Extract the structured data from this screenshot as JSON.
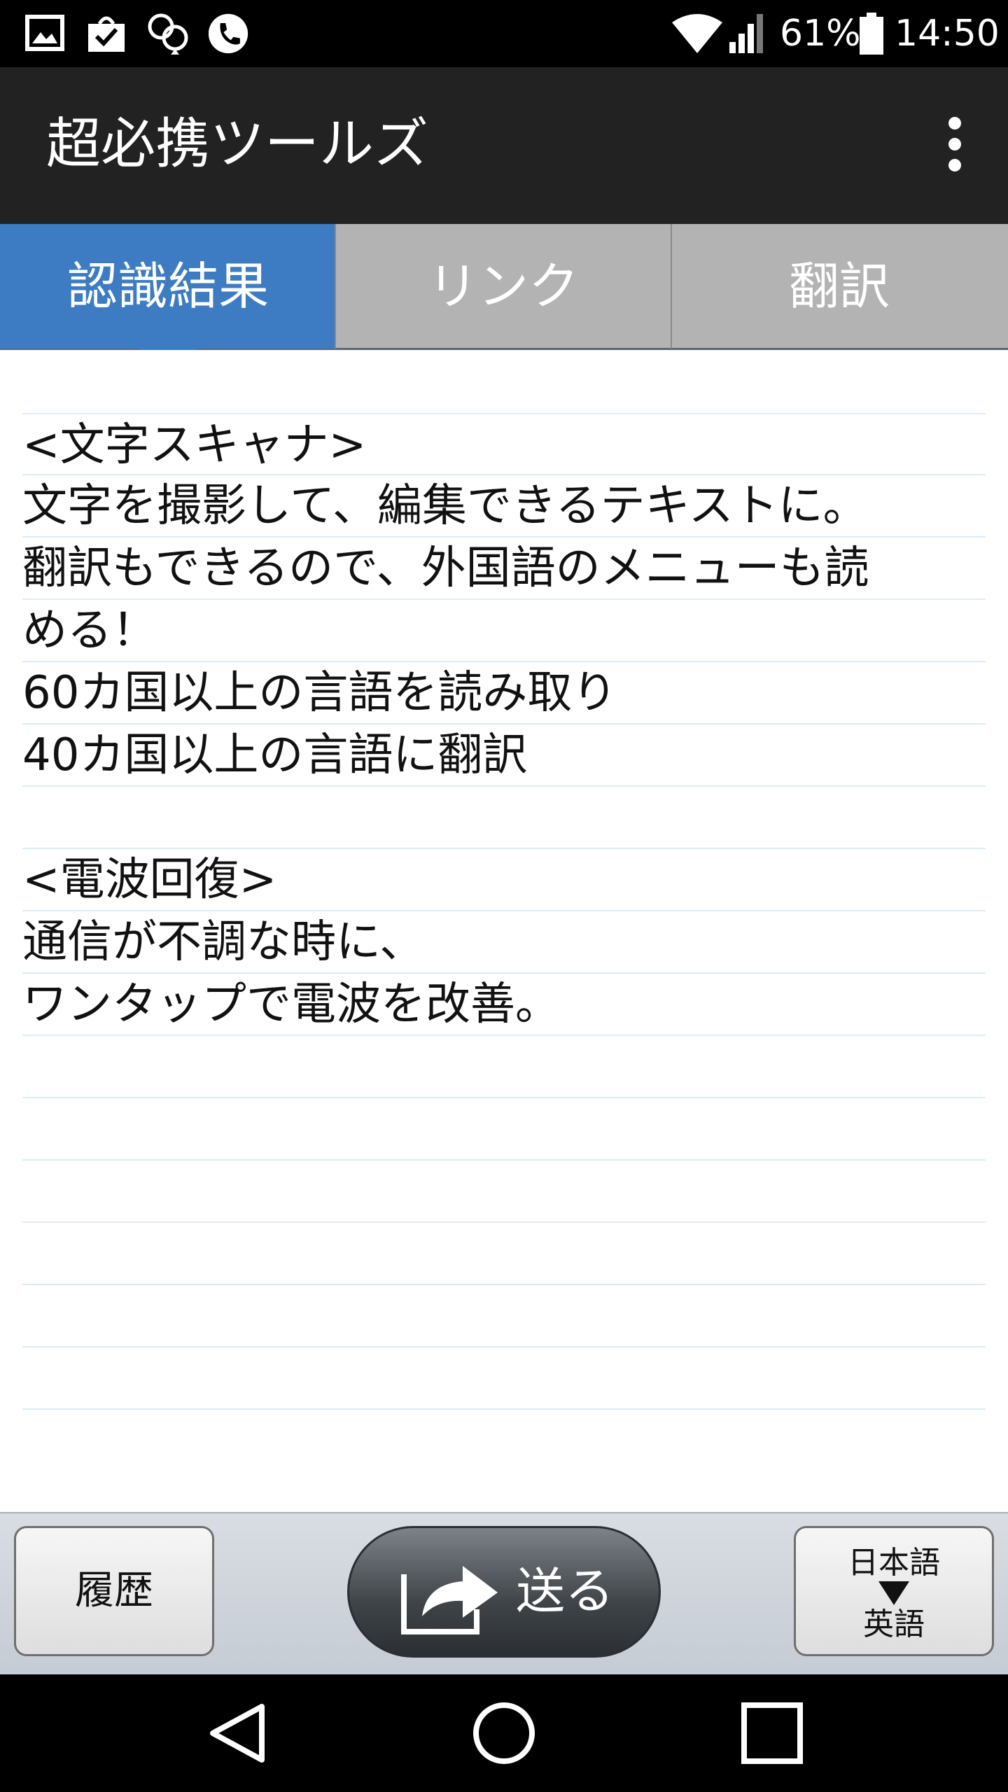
{
  "status_bar": {
    "battery": "61%",
    "time": "14:50",
    "icons": [
      "image-icon",
      "shopping-bag-check-icon",
      "location-pins-icon",
      "phone-icon",
      "wifi-icon",
      "signal-icon",
      "battery-icon"
    ]
  },
  "app_bar": {
    "title": "超必携ツールズ",
    "menu_icon": "overflow-menu-icon"
  },
  "tabs": [
    {
      "label": "認識結果",
      "active": true
    },
    {
      "label": "リンク",
      "active": false
    },
    {
      "label": "翻訳",
      "active": false
    }
  ],
  "content": {
    "lines": [
      "<文字スキャナ>",
      "文字を撮影して、編集できるテキストに。",
      "翻訳もできるので、外国語のメニューも読",
      "める！",
      "60カ国以上の言語を読み取り",
      "40カ国以上の言語に翻訳",
      "",
      "<電波回復>",
      "通信が不調な時に、",
      "ワンタップで電波を改善。",
      "",
      "",
      "",
      "",
      "",
      ""
    ]
  },
  "bottom_bar": {
    "history_label": "履歴",
    "send_label": "送る",
    "language_from": "日本語",
    "language_to": "英語"
  },
  "colors": {
    "accent_blue": "#3d7cc3",
    "app_bar": "#222222",
    "tab_inactive": "#b3b3b3",
    "rule_line": "#dcecf5"
  },
  "navigation": {
    "icons": [
      "back-icon",
      "home-icon",
      "recents-icon"
    ]
  }
}
